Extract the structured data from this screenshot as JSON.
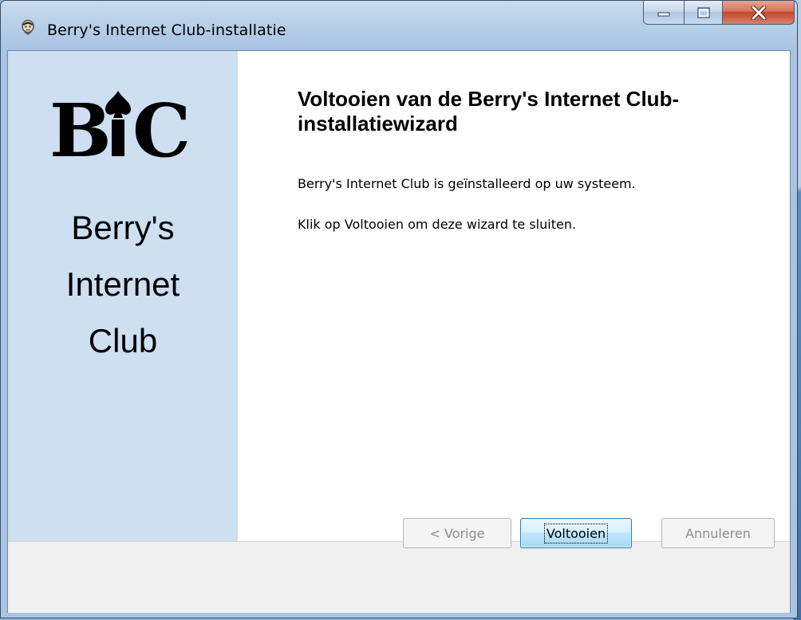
{
  "window": {
    "title": "Berry's Internet Club-installatie",
    "accent": "#a9c4e2",
    "close_color": "#c2462a"
  },
  "sidebar": {
    "logo_text": "BiC",
    "name_lines": [
      "Berry's",
      "Internet",
      "Club"
    ],
    "background": "#cddff0"
  },
  "content": {
    "title": "Voltooien van de Berry's Internet Club-installatiewizard",
    "line1": "Berry's Internet Club is geïnstalleerd op uw systeem.",
    "line2": "Klik op Voltooien om deze wizard te sluiten."
  },
  "buttons": {
    "back": "< Vorige",
    "finish": "Voltooien",
    "cancel": "Annuleren"
  },
  "icons": {
    "app": "app-icon",
    "minimize": "minimize-icon",
    "maximize": "maximize-icon",
    "close": "close-icon",
    "spade": "spade-icon"
  }
}
